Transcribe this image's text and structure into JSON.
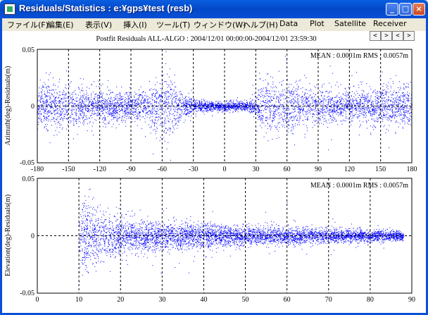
{
  "window": {
    "title": "Residuals/Statistics : e:¥gps¥test (resb)",
    "minimize": "_",
    "maximize": "□",
    "close": "×"
  },
  "menu": [
    "ファイル(F)",
    "編集(E)",
    "表示(V)",
    "挿入(I)",
    "ツール(T)",
    "ウィンドウ(W)",
    "ヘルプ(H)",
    "Data",
    "Plot",
    "Satellite",
    "Receiver"
  ],
  "nav_buttons": [
    "<",
    ">",
    "<",
    ">"
  ],
  "colors": {
    "points": "#0000ff",
    "frame": "#000000"
  },
  "chart_data": [
    {
      "type": "scatter",
      "title": "Postfit Residuals ALL-ALGO : 2004/12/01 00:00:00-2004/12/01 23:59:30",
      "ylabel": "Azimuth(deg)-Residuals(m)",
      "annotation": "MEAN : 0.0001m RMS : 0.0057m",
      "xlim": [
        -180,
        180
      ],
      "ylim": [
        -0.05,
        0.05
      ],
      "x_ticks": [
        -180,
        -150,
        -120,
        -90,
        -60,
        -30,
        0,
        30,
        60,
        90,
        120,
        150,
        180
      ],
      "y_ticks": [
        "0.05",
        "0",
        "-0.05"
      ],
      "grid": "vertical dashed",
      "series_color": "#0000ff",
      "spread_profile": [
        [
          -180,
          0.008
        ],
        [
          -165,
          0.01
        ],
        [
          -150,
          0.009
        ],
        [
          -130,
          0.008
        ],
        [
          -110,
          0.007
        ],
        [
          -90,
          0.006
        ],
        [
          -75,
          0.008
        ],
        [
          -62,
          0.012
        ],
        [
          -55,
          0.016
        ],
        [
          -48,
          0.011
        ],
        [
          -40,
          0.004
        ],
        [
          -30,
          0.003
        ],
        [
          -10,
          0.002
        ],
        [
          0,
          0.002
        ],
        [
          20,
          0.002
        ],
        [
          30,
          0.004
        ],
        [
          35,
          0.011
        ],
        [
          50,
          0.012
        ],
        [
          65,
          0.01
        ],
        [
          80,
          0.008
        ],
        [
          100,
          0.007
        ],
        [
          120,
          0.007
        ],
        [
          140,
          0.008
        ],
        [
          160,
          0.008
        ],
        [
          180,
          0.009
        ]
      ]
    },
    {
      "type": "scatter",
      "ylabel": "Elevation(deg)-Residuals(m)",
      "annotation": "MEAN : 0.0001m RMS : 0.0057m",
      "xlim": [
        0,
        90
      ],
      "ylim": [
        -0.05,
        0.05
      ],
      "x_ticks": [
        0,
        10,
        20,
        30,
        40,
        50,
        60,
        70,
        80,
        90
      ],
      "y_ticks": [
        "0.05",
        "0",
        "-0.05"
      ],
      "grid": "vertical dashed",
      "series_color": "#0000ff",
      "spread_profile": [
        [
          10,
          0.016
        ],
        [
          12,
          0.014
        ],
        [
          15,
          0.011
        ],
        [
          20,
          0.008
        ],
        [
          30,
          0.006
        ],
        [
          40,
          0.005
        ],
        [
          50,
          0.004
        ],
        [
          60,
          0.0035
        ],
        [
          70,
          0.003
        ],
        [
          80,
          0.0025
        ],
        [
          88,
          0.002
        ]
      ]
    }
  ]
}
